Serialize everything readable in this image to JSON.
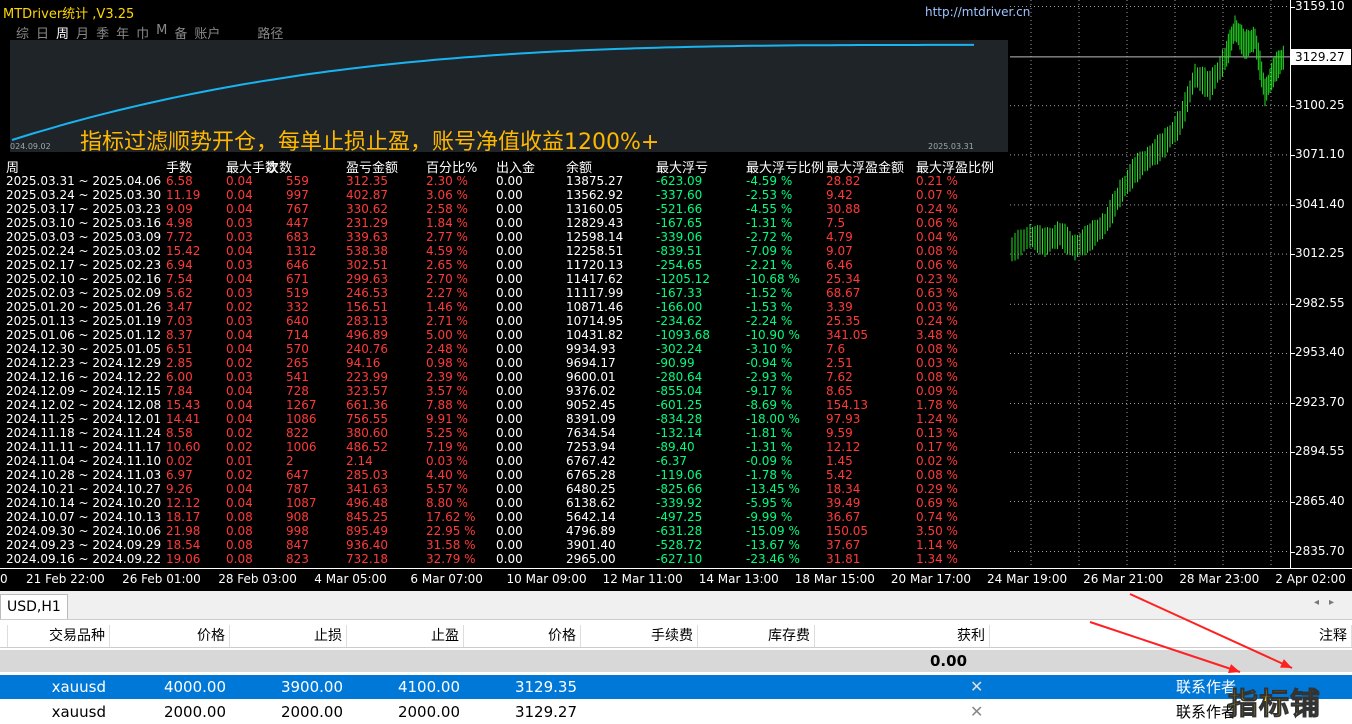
{
  "panel": {
    "title": "MTDriver统计 ,V3.25",
    "url": "http://mtdriver.cn",
    "tabs": [
      "综",
      "日",
      "周",
      "月",
      "季",
      "年",
      "巾",
      "M",
      "备",
      "账户",
      "",
      "路径"
    ],
    "active_tab": 2,
    "headline": "指标过滤顺势开仓，每单止损止盈，账号净值收益1200%+",
    "equity_start_date": "024.09.02",
    "equity_end_date": "2025.03.31",
    "equity_curve_color": "#19b4f0"
  },
  "table": {
    "headers": [
      "周",
      "手数",
      "最大手数",
      "次数",
      "盈亏金额",
      "百分比%",
      "出入金",
      "余额",
      "最大浮亏",
      "最大浮亏比例",
      "最大浮盈金额",
      "最大浮盈比例"
    ],
    "rows": [
      [
        "2025.03.31 ~ 2025.04.06",
        "6.58",
        "0.04",
        "559",
        "312.35",
        "2.30 %",
        "0.00",
        "13875.27",
        "-623.09",
        "-4.59 %",
        "28.82",
        "0.21 %"
      ],
      [
        "2025.03.24 ~ 2025.03.30",
        "11.19",
        "0.04",
        "997",
        "402.87",
        "3.06 %",
        "0.00",
        "13562.92",
        "-337.60",
        "-2.53 %",
        "9.42",
        "0.07 %"
      ],
      [
        "2025.03.17 ~ 2025.03.23",
        "9.09",
        "0.04",
        "767",
        "330.62",
        "2.58 %",
        "0.00",
        "13160.05",
        "-521.66",
        "-4.55 %",
        "30.88",
        "0.24 %"
      ],
      [
        "2025.03.10 ~ 2025.03.16",
        "4.98",
        "0.03",
        "447",
        "231.29",
        "1.84 %",
        "0.00",
        "12829.43",
        "-167.65",
        "-1.31 %",
        "7.5",
        "0.06 %"
      ],
      [
        "2025.03.03 ~ 2025.03.09",
        "7.72",
        "0.03",
        "683",
        "339.63",
        "2.77 %",
        "0.00",
        "12598.14",
        "-339.06",
        "-2.72 %",
        "4.79",
        "0.04 %"
      ],
      [
        "2025.02.24 ~ 2025.03.02",
        "15.42",
        "0.04",
        "1312",
        "538.38",
        "4.59 %",
        "0.00",
        "12258.51",
        "-839.51",
        "-7.09 %",
        "9.07",
        "0.08 %"
      ],
      [
        "2025.02.17 ~ 2025.02.23",
        "6.94",
        "0.03",
        "646",
        "302.51",
        "2.65 %",
        "0.00",
        "11720.13",
        "-254.65",
        "-2.21 %",
        "6.46",
        "0.06 %"
      ],
      [
        "2025.02.10 ~ 2025.02.16",
        "7.54",
        "0.04",
        "671",
        "299.63",
        "2.70 %",
        "0.00",
        "11417.62",
        "-1205.12",
        "-10.68 %",
        "25.34",
        "0.23 %"
      ],
      [
        "2025.02.03 ~ 2025.02.09",
        "5.62",
        "0.03",
        "519",
        "246.53",
        "2.27 %",
        "0.00",
        "11117.99",
        "-167.33",
        "-1.52 %",
        "68.67",
        "0.63 %"
      ],
      [
        "2025.01.20 ~ 2025.01.26",
        "3.47",
        "0.02",
        "332",
        "156.51",
        "1.46 %",
        "0.00",
        "10871.46",
        "-166.00",
        "-1.53 %",
        "3.39",
        "0.03 %"
      ],
      [
        "2025.01.13 ~ 2025.01.19",
        "7.03",
        "0.03",
        "640",
        "283.13",
        "2.71 %",
        "0.00",
        "10714.95",
        "-234.62",
        "-2.24 %",
        "25.35",
        "0.24 %"
      ],
      [
        "2025.01.06 ~ 2025.01.12",
        "8.37",
        "0.04",
        "714",
        "496.89",
        "5.00 %",
        "0.00",
        "10431.82",
        "-1093.68",
        "-10.90 %",
        "341.05",
        "3.48 %"
      ],
      [
        "2024.12.30 ~ 2025.01.05",
        "6.51",
        "0.04",
        "570",
        "240.76",
        "2.48 %",
        "0.00",
        "9934.93",
        "-302.24",
        "-3.10 %",
        "7.6",
        "0.08 %"
      ],
      [
        "2024.12.23 ~ 2024.12.29",
        "2.85",
        "0.02",
        "265",
        "94.16",
        "0.98 %",
        "0.00",
        "9694.17",
        "-90.99",
        "-0.94 %",
        "2.51",
        "0.03 %"
      ],
      [
        "2024.12.16 ~ 2024.12.22",
        "6.00",
        "0.03",
        "541",
        "223.99",
        "2.39 %",
        "0.00",
        "9600.01",
        "-280.64",
        "-2.93 %",
        "7.62",
        "0.08 %"
      ],
      [
        "2024.12.09 ~ 2024.12.15",
        "7.84",
        "0.04",
        "728",
        "323.57",
        "3.57 %",
        "0.00",
        "9376.02",
        "-855.04",
        "-9.17 %",
        "8.65",
        "0.09 %"
      ],
      [
        "2024.12.02 ~ 2024.12.08",
        "15.43",
        "0.04",
        "1267",
        "661.36",
        "7.88 %",
        "0.00",
        "9052.45",
        "-601.25",
        "-8.69 %",
        "154.13",
        "1.78 %"
      ],
      [
        "2024.11.25 ~ 2024.12.01",
        "14.41",
        "0.04",
        "1086",
        "756.55",
        "9.91 %",
        "0.00",
        "8391.09",
        "-834.28",
        "-18.00 %",
        "97.93",
        "1.24 %"
      ],
      [
        "2024.11.18 ~ 2024.11.24",
        "8.58",
        "0.02",
        "822",
        "380.60",
        "5.25 %",
        "0.00",
        "7634.54",
        "-132.14",
        "-1.81 %",
        "9.59",
        "0.13 %"
      ],
      [
        "2024.11.11 ~ 2024.11.17",
        "10.60",
        "0.02",
        "1006",
        "486.52",
        "7.19 %",
        "0.00",
        "7253.94",
        "-89.40",
        "-1.31 %",
        "12.12",
        "0.17 %"
      ],
      [
        "2024.11.04 ~ 2024.11.10",
        "0.02",
        "0.01",
        "2",
        "2.14",
        "0.03 %",
        "0.00",
        "6767.42",
        "-6.37",
        "-0.09 %",
        "1.45",
        "0.02 %"
      ],
      [
        "2024.10.28 ~ 2024.11.03",
        "6.97",
        "0.02",
        "647",
        "285.03",
        "4.40 %",
        "0.00",
        "6765.28",
        "-119.06",
        "-1.78 %",
        "5.42",
        "0.08 %"
      ],
      [
        "2024.10.21 ~ 2024.10.27",
        "9.26",
        "0.04",
        "787",
        "341.63",
        "5.57 %",
        "0.00",
        "6480.25",
        "-825.66",
        "-13.45 %",
        "18.34",
        "0.29 %"
      ],
      [
        "2024.10.14 ~ 2024.10.20",
        "12.12",
        "0.04",
        "1087",
        "496.48",
        "8.80 %",
        "0.00",
        "6138.62",
        "-339.92",
        "-5.95 %",
        "39.49",
        "0.69 %"
      ],
      [
        "2024.10.07 ~ 2024.10.13",
        "18.17",
        "0.08",
        "908",
        "845.25",
        "17.62 %",
        "0.00",
        "5642.14",
        "-497.25",
        "-9.99 %",
        "36.67",
        "0.74 %"
      ],
      [
        "2024.09.30 ~ 2024.10.06",
        "21.98",
        "0.08",
        "998",
        "895.49",
        "22.95 %",
        "0.00",
        "4796.89",
        "-631.28",
        "-15.09 %",
        "150.05",
        "3.50 %"
      ],
      [
        "2024.09.23 ~ 2024.09.29",
        "18.54",
        "0.08",
        "847",
        "936.40",
        "31.58 %",
        "0.00",
        "3901.40",
        "-528.72",
        "-13.67 %",
        "37.67",
        "1.14 %"
      ],
      [
        "2024.09.16 ~ 2024.09.22",
        "19.06",
        "0.08",
        "823",
        "732.18",
        "32.79 %",
        "0.00",
        "2965.00",
        "-627.10",
        "-23.46 %",
        "31.81",
        "1.34 %"
      ]
    ]
  },
  "price_axis": {
    "labels": [
      "3159.10",
      "3100.25",
      "3071.10",
      "3041.40",
      "3012.25",
      "2982.55",
      "2953.40",
      "2923.70",
      "2894.55",
      "2865.40",
      "2835.70"
    ],
    "current": "3129.27",
    "min": 2826.0,
    "max": 3163.0
  },
  "time_axis": {
    "labels": [
      "0",
      "21 Feb 22:00",
      "26 Feb 01:00",
      "28 Feb 03:00",
      "4 Mar 05:00",
      "6 Mar 07:00",
      "10 Mar 09:00",
      "12 Mar 11:00",
      "14 Mar 13:00",
      "18 Mar 15:00",
      "20 Mar 17:00",
      "24 Mar 19:00",
      "26 Mar 21:00",
      "28 Mar 23:00",
      "2 Apr 02:00"
    ]
  },
  "terminal": {
    "tab": "USD,H1",
    "columns": [
      "交易品种",
      "价格",
      "止损",
      "止盈",
      "价格",
      "手续费",
      "库存费",
      "获利",
      "注释"
    ],
    "summary_profit": "0.00",
    "orders": [
      {
        "symbol": "xauusd",
        "price": "4000.00",
        "sl": "3900.00",
        "tp": "4100.00",
        "current": "3129.35",
        "comment": "联系作者",
        "selected": true
      },
      {
        "symbol": "xauusd",
        "price": "2000.00",
        "sl": "2000.00",
        "tp": "2000.00",
        "current": "3129.27",
        "comment": "联系作者",
        "selected": false
      }
    ],
    "watermark": "指标铺"
  }
}
